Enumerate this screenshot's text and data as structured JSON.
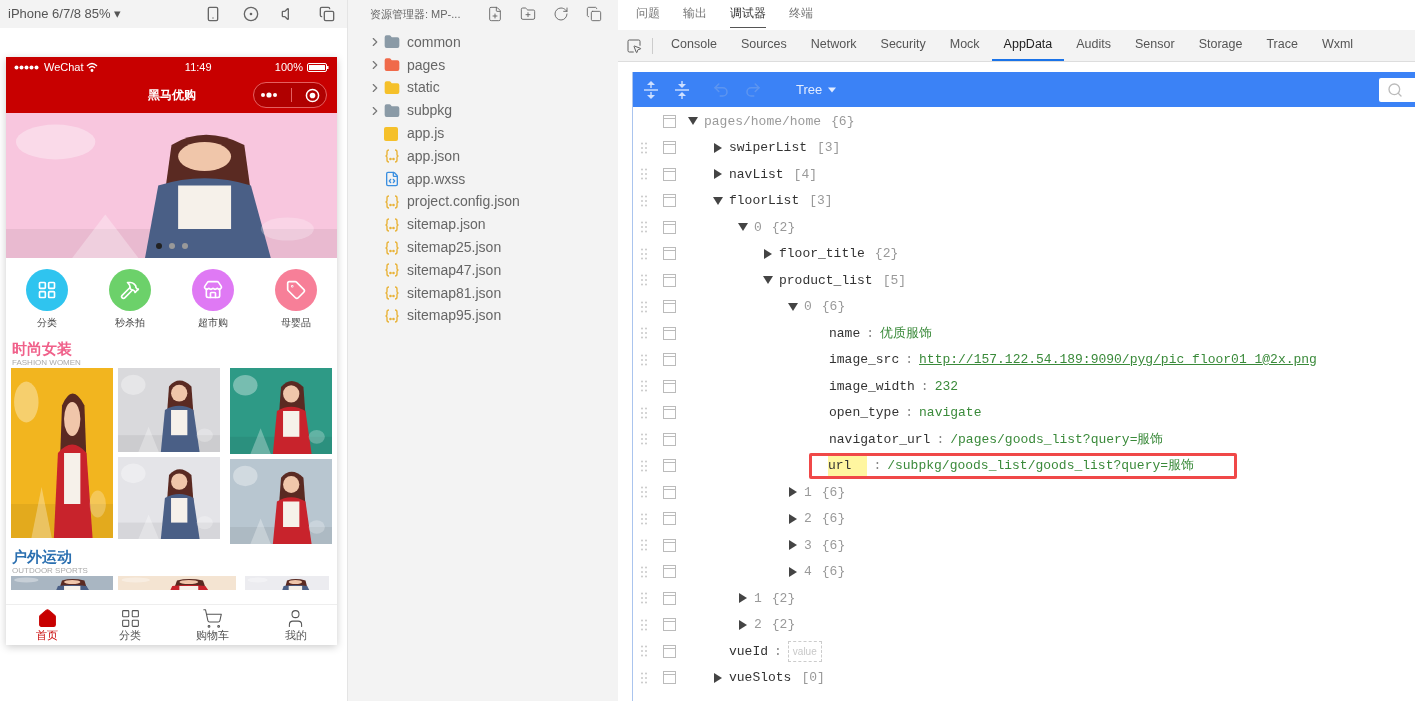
{
  "simulator": {
    "device": "iPhone 6/7/8 85% ▾",
    "phone": {
      "carrier": "WeChat",
      "time": "11:49",
      "battery": "100%",
      "title": "黑马优购",
      "swiper_dots": [
        {
          "selected": true
        },
        {
          "selected": false
        },
        {
          "selected": false
        }
      ],
      "nav": [
        {
          "label": "分类",
          "color": "#2fc4ef"
        },
        {
          "label": "秒杀拍",
          "color": "#6cd16a"
        },
        {
          "label": "超市购",
          "color": "#df79f4"
        },
        {
          "label": "母婴品",
          "color": "#f77f98"
        }
      ],
      "floors": [
        {
          "title": "时尚女装",
          "subtitle": "FASHION WOMEN",
          "color": "#f0608a"
        },
        {
          "title": "户外运动",
          "subtitle": "OUTDOOR SPORTS",
          "color": "#2a6fb0"
        }
      ],
      "tabbar": [
        {
          "label": "首页",
          "selected": true
        },
        {
          "label": "分类",
          "selected": false
        },
        {
          "label": "购物车",
          "selected": false
        },
        {
          "label": "我的",
          "selected": false
        }
      ]
    }
  },
  "explorer": {
    "title": "资源管理器: MP-...",
    "items": [
      {
        "name": "common",
        "kind": "folder",
        "color": "#8a9aa6"
      },
      {
        "name": "pages",
        "kind": "folder",
        "color": "#f06a4a"
      },
      {
        "name": "static",
        "kind": "folder",
        "color": "#f5c02a"
      },
      {
        "name": "subpkg",
        "kind": "folder",
        "color": "#8a9aa6"
      },
      {
        "name": "app.js",
        "kind": "js"
      },
      {
        "name": "app.json",
        "kind": "json"
      },
      {
        "name": "app.wxss",
        "kind": "wxss"
      },
      {
        "name": "project.config.json",
        "kind": "json"
      },
      {
        "name": "sitemap.json",
        "kind": "json"
      },
      {
        "name": "sitemap25.json",
        "kind": "json"
      },
      {
        "name": "sitemap47.json",
        "kind": "json"
      },
      {
        "name": "sitemap81.json",
        "kind": "json"
      },
      {
        "name": "sitemap95.json",
        "kind": "json"
      }
    ]
  },
  "devtools": {
    "panel_tabs": [
      {
        "label": "问题",
        "selected": false
      },
      {
        "label": "输出",
        "selected": false
      },
      {
        "label": "调试器",
        "selected": true
      },
      {
        "label": "终端",
        "selected": false
      }
    ],
    "tabs": [
      {
        "label": "Console",
        "selected": false
      },
      {
        "label": "Sources",
        "selected": false
      },
      {
        "label": "Network",
        "selected": false
      },
      {
        "label": "Security",
        "selected": false
      },
      {
        "label": "Mock",
        "selected": false
      },
      {
        "label": "AppData",
        "selected": true
      },
      {
        "label": "Audits",
        "selected": false
      },
      {
        "label": "Sensor",
        "selected": false
      },
      {
        "label": "Storage",
        "selected": false
      },
      {
        "label": "Trace",
        "selected": false
      },
      {
        "label": "Wxml",
        "selected": false
      }
    ],
    "view_mode": "Tree",
    "tree": [
      {
        "key": "pages/home/home",
        "kind": "root",
        "summary": "{6}",
        "expanded": true,
        "children": [
          {
            "key": "swiperList",
            "kind": "branch",
            "summary": "[3]",
            "expanded": false
          },
          {
            "key": "navList",
            "kind": "branch",
            "summary": "[4]",
            "expanded": false
          },
          {
            "key": "floorList",
            "kind": "branch",
            "summary": "[3]",
            "expanded": true,
            "children": [
              {
                "key": "0",
                "kind": "item",
                "summary": "{2}",
                "expanded": true,
                "children": [
                  {
                    "key": "floor_title",
                    "kind": "branch",
                    "summary": "{2}",
                    "expanded": false
                  },
                  {
                    "key": "product_list",
                    "kind": "branch",
                    "summary": "[5]",
                    "expanded": true,
                    "children": [
                      {
                        "key": "0",
                        "kind": "item",
                        "summary": "{6}",
                        "expanded": true,
                        "children": [
                          {
                            "key": "name",
                            "kind": "text",
                            "sep": ":",
                            "value": "优质服饰"
                          },
                          {
                            "key": "image_src",
                            "kind": "link",
                            "sep": ":",
                            "value": "http://157.122.54.189:9090/pyg/pic_floor01_1@2x.png"
                          },
                          {
                            "key": "image_width",
                            "kind": "text",
                            "sep": ":",
                            "value": "232"
                          },
                          {
                            "key": "open_type",
                            "kind": "text",
                            "sep": ":",
                            "value": "navigate"
                          },
                          {
                            "key": "navigator_url",
                            "kind": "text",
                            "sep": ":",
                            "value": "/pages/goods_list?query=服饰"
                          },
                          {
                            "key": "url",
                            "kind": "text",
                            "sep": ":",
                            "value": "/subpkg/goods_list/goods_list?query=服饰",
                            "highlighted": true
                          }
                        ]
                      },
                      {
                        "key": "1",
                        "kind": "item",
                        "summary": "{6}",
                        "expanded": false
                      },
                      {
                        "key": "2",
                        "kind": "item",
                        "summary": "{6}",
                        "expanded": false
                      },
                      {
                        "key": "3",
                        "kind": "item",
                        "summary": "{6}",
                        "expanded": false
                      },
                      {
                        "key": "4",
                        "kind": "item",
                        "summary": "{6}",
                        "expanded": false
                      }
                    ]
                  }
                ]
              },
              {
                "key": "1",
                "kind": "item",
                "summary": "{2}",
                "expanded": false
              },
              {
                "key": "2",
                "kind": "item",
                "summary": "{2}",
                "expanded": false
              }
            ]
          },
          {
            "key": "vueId",
            "kind": "empty",
            "sep": ":",
            "placeholder": "value"
          },
          {
            "key": "vueSlots",
            "kind": "branch",
            "summary": "[0]",
            "expanded": false
          }
        ]
      }
    ]
  }
}
